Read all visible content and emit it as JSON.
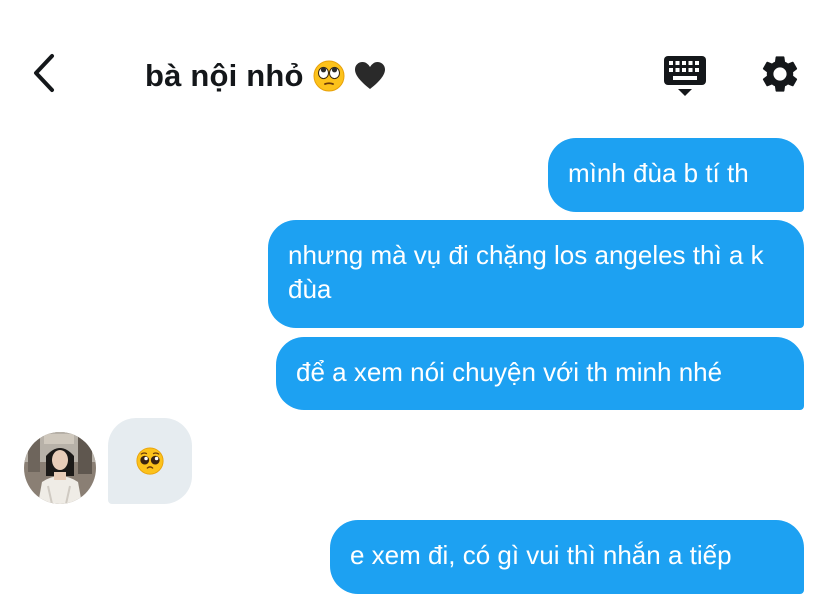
{
  "header": {
    "title": "bà nội nhỏ",
    "title_emojis": [
      "face-with-rolling-eyes-icon",
      "black-heart-icon"
    ],
    "back_icon": "chevron-left-icon",
    "keyboard_icon": "keyboard-icon",
    "settings_icon": "gear-icon"
  },
  "messages": [
    {
      "direction": "out",
      "text": "mình đùa b tí th"
    },
    {
      "direction": "out",
      "text": "nhưng mà vụ đi chặng los angeles thì a k đùa"
    },
    {
      "direction": "out",
      "text": "để a xem nói chuyện với th minh nhé"
    },
    {
      "direction": "in",
      "emoji": "pleading-face-icon"
    },
    {
      "direction": "out",
      "text": "e xem đi, có gì vui thì nhắn a tiếp"
    }
  ],
  "colors": {
    "outgoing_bubble": "#1da1f2",
    "incoming_bubble": "#e6ecf0",
    "text": "#14171a"
  }
}
